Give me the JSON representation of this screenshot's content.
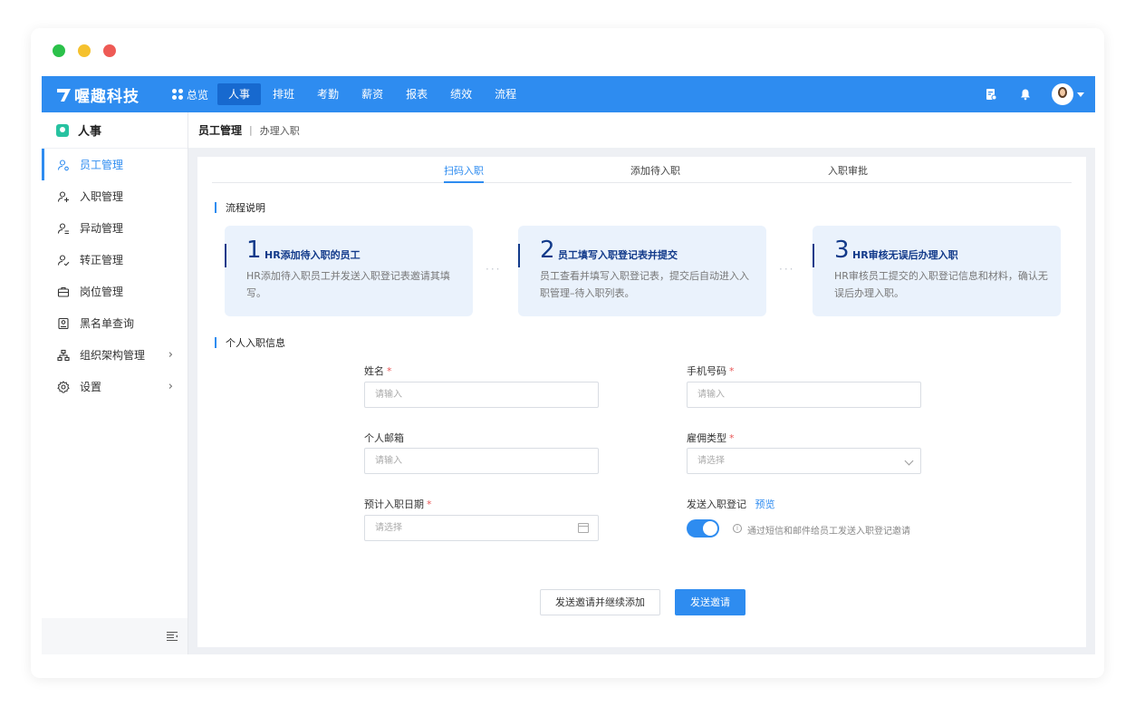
{
  "window": {
    "controls": [
      {
        "name": "window-dot-green-button",
        "color": "#2bc14a"
      },
      {
        "name": "window-dot-yellow-button",
        "color": "#f5c12e"
      },
      {
        "name": "window-dot-red-button",
        "color": "#ee5a55"
      }
    ]
  },
  "colors": {
    "accent": "#2e8cf0",
    "stepText": "#123a8a",
    "stepBg": "#eaf2fc",
    "required": "#e85757"
  },
  "topbar": {
    "brand": "喔趣科技",
    "overview_label": "总览",
    "nav": [
      {
        "label": "人事",
        "active": true
      },
      {
        "label": "排班"
      },
      {
        "label": "考勤"
      },
      {
        "label": "薪资"
      },
      {
        "label": "报表"
      },
      {
        "label": "绩效"
      },
      {
        "label": "流程"
      }
    ],
    "icons": [
      "document-icon",
      "bell-icon",
      "avatar",
      "chevron-down-icon"
    ]
  },
  "sidebar": {
    "header": "人事",
    "items": [
      {
        "label": "员工管理",
        "icon": "user-group-icon",
        "active": true
      },
      {
        "label": "入职管理",
        "icon": "user-add-icon"
      },
      {
        "label": "异动管理",
        "icon": "user-change-icon"
      },
      {
        "label": "转正管理",
        "icon": "user-check-icon"
      },
      {
        "label": "岗位管理",
        "icon": "briefcase-icon"
      },
      {
        "label": "黑名单查询",
        "icon": "blacklist-icon"
      },
      {
        "label": "组织架构管理",
        "icon": "org-chart-icon",
        "has_children": true,
        "arrow": "›"
      },
      {
        "label": "设置",
        "icon": "gear-icon",
        "has_children": true,
        "arrow": "›"
      }
    ]
  },
  "breadcrumb": {
    "main": "员工管理",
    "separator": "|",
    "sub": "办理入职"
  },
  "tabs": [
    {
      "label": "扫码入职",
      "active": true
    },
    {
      "label": "添加待入职"
    },
    {
      "label": "入职审批"
    }
  ],
  "process": {
    "title": "流程说明",
    "steps": [
      {
        "num": "1",
        "title": "HR添加待入职的员工",
        "desc": "HR添加待入职员工并发送入职登记表邀请其填写。"
      },
      {
        "num": "2",
        "title": "员工填写入职登记表并提交",
        "desc": "员工查看并填写入职登记表，提交后自动进入入职管理–待入职列表。"
      },
      {
        "num": "3",
        "title": "HR审核无误后办理入职",
        "desc": "HR审核员工提交的入职登记信息和材料，确认无误后办理入职。"
      }
    ],
    "dots": "···"
  },
  "form": {
    "title": "个人入职信息",
    "required_mark": "*",
    "name": {
      "label": "姓名",
      "placeholder": "请输入"
    },
    "phone": {
      "label": "手机号码",
      "placeholder": "请输入"
    },
    "email": {
      "label": "个人邮箱",
      "placeholder": "请输入"
    },
    "employment_type": {
      "label": "雇佣类型",
      "placeholder": "请选择"
    },
    "entry_date": {
      "label": "预计入职日期",
      "placeholder": "请选择"
    },
    "send_registration": {
      "label": "发送入职登记",
      "preview": "预览",
      "enabled": true,
      "hint_icon": "i",
      "hint": "通过短信和邮件给员工发送入职登记邀请"
    }
  },
  "actions": {
    "secondary": "发送邀请并继续添加",
    "primary": "发送邀请"
  }
}
